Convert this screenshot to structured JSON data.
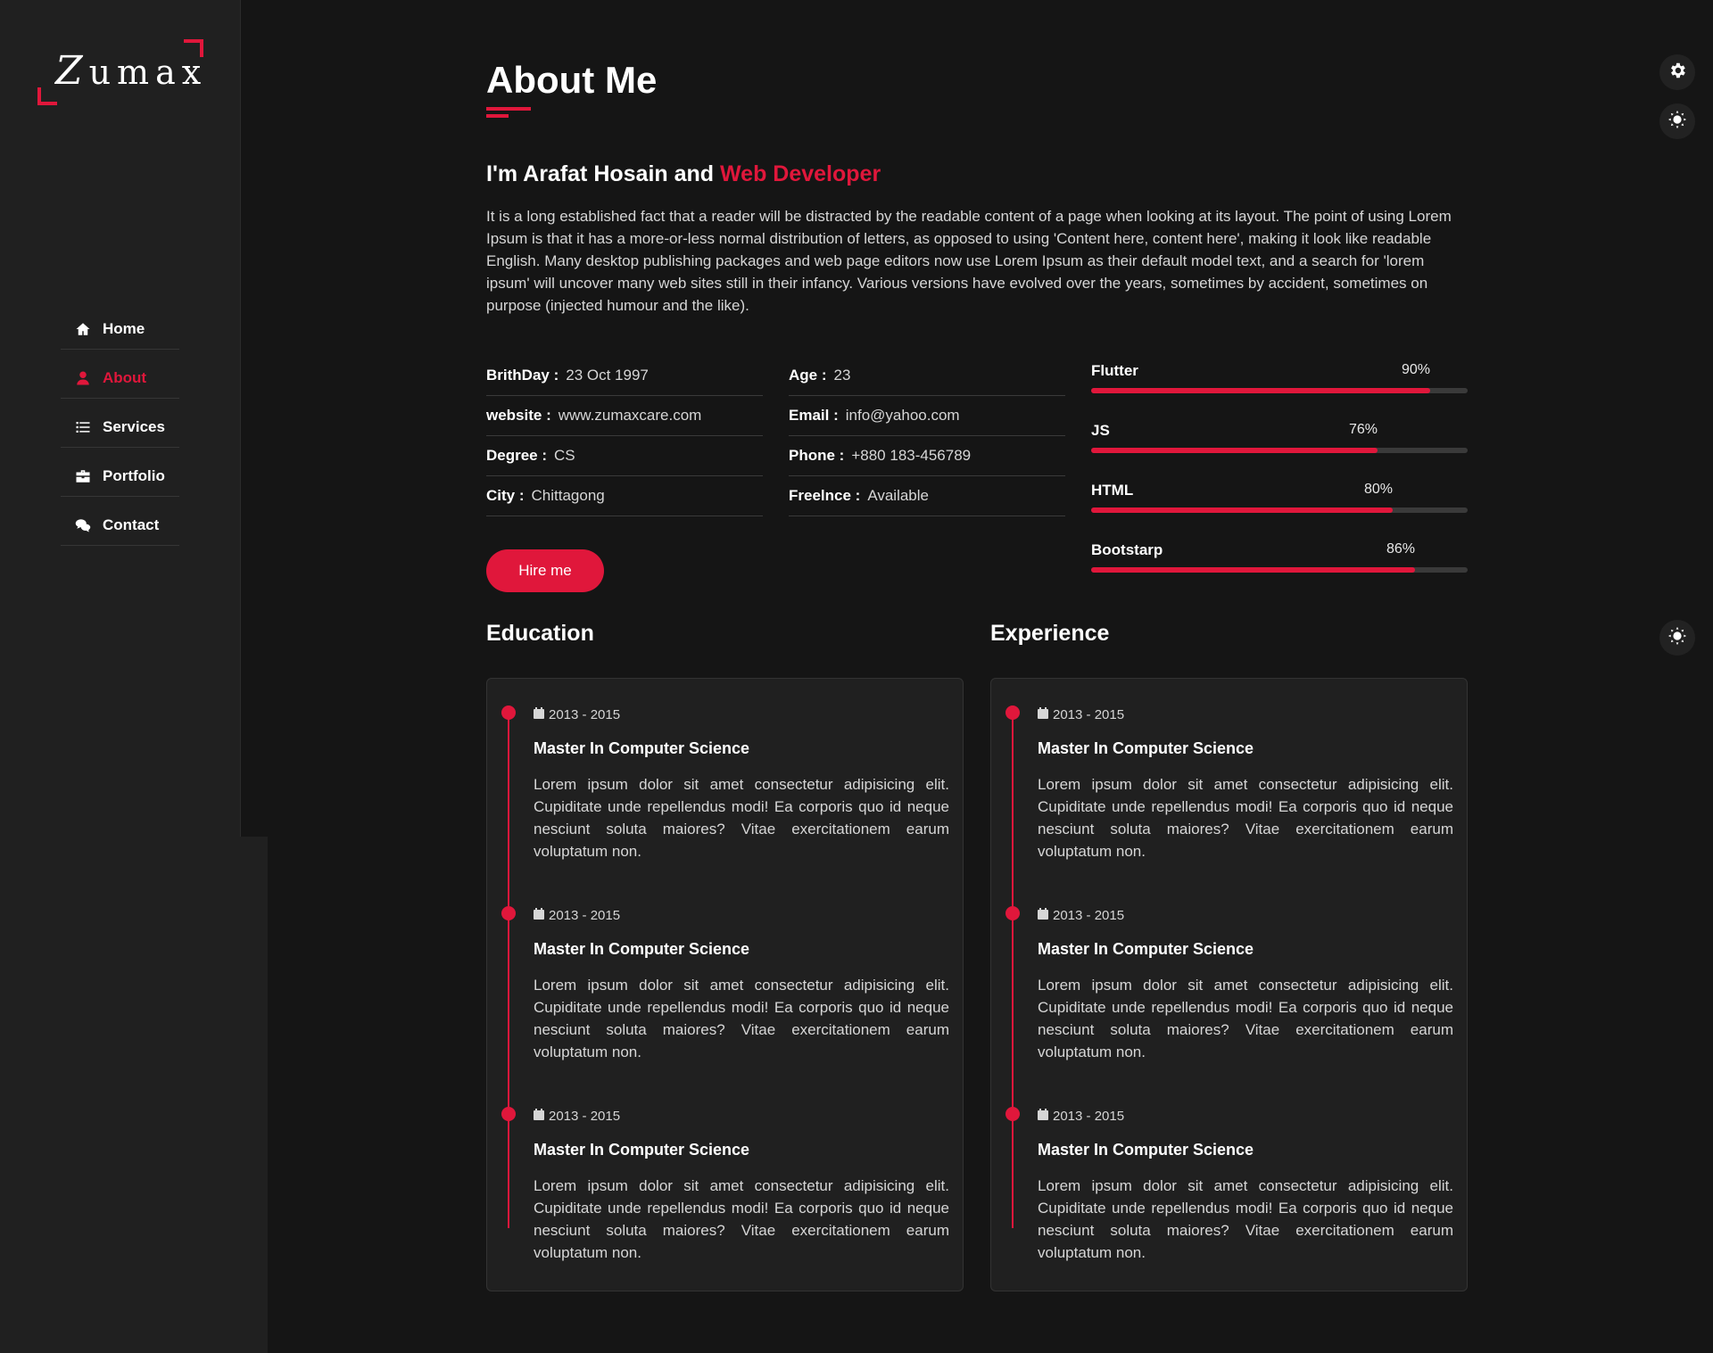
{
  "logo": {
    "first_letter": "Z",
    "rest": "umax"
  },
  "nav": {
    "items": [
      {
        "label": "Home",
        "icon": "home-icon"
      },
      {
        "label": "About",
        "icon": "user-icon"
      },
      {
        "label": "Services",
        "icon": "list-icon"
      },
      {
        "label": "Portfolio",
        "icon": "briefcase-icon"
      },
      {
        "label": "Contact",
        "icon": "comments-icon"
      }
    ],
    "active": "About"
  },
  "fabs": [
    "gear-icon",
    "sun-icon",
    "sun-icon"
  ],
  "about": {
    "title": "About Me",
    "heading_prefix": "I'm Arafat Hosain and",
    "heading_accent": "Web Developer",
    "intro": "It is a long established fact that a reader will be distracted by the readable content of a page when looking at its layout. The point of using Lorem Ipsum is that it has a more-or-less normal distribution of letters, as opposed to using 'Content here, content here', making it look like readable English. Many desktop publishing packages and web page editors now use Lorem Ipsum as their default model text, and a search for 'lorem ipsum' will uncover many web sites still in their infancy. Various versions have evolved over the years, sometimes by accident, sometimes on purpose (injected humour and the like).",
    "info_left": [
      {
        "k": "BrithDay :",
        "v": "23 Oct 1997"
      },
      {
        "k": "website :",
        "v": "www.zumaxcare.com"
      },
      {
        "k": "Degree :",
        "v": "CS"
      },
      {
        "k": "City :",
        "v": "Chittagong"
      }
    ],
    "info_right": [
      {
        "k": "Age :",
        "v": "23"
      },
      {
        "k": "Email :",
        "v": "info@yahoo.com"
      },
      {
        "k": "Phone :",
        "v": "+880 183-456789"
      },
      {
        "k": "Freelnce :",
        "v": "Available"
      }
    ],
    "skills": [
      {
        "name": "Flutter",
        "pct_label": "90%",
        "pct": 90
      },
      {
        "name": "JS",
        "pct_label": "76%",
        "pct": 76
      },
      {
        "name": "HTML",
        "pct_label": "80%",
        "pct": 80
      },
      {
        "name": "Bootstarp",
        "pct_label": "86%",
        "pct": 86
      }
    ],
    "hire_label": "Hire me"
  },
  "education": {
    "title": "Education",
    "entries": [
      {
        "date": "2013 - 2015",
        "title": "Master In Computer Science",
        "desc": "Lorem ipsum dolor sit amet consectetur adipisicing elit. Cupiditate unde repellendus modi! Ea corporis quo id neque nesciunt soluta maiores? Vitae exercitationem earum voluptatum non."
      },
      {
        "date": "2013 - 2015",
        "title": "Master In Computer Science",
        "desc": "Lorem ipsum dolor sit amet consectetur adipisicing elit. Cupiditate unde repellendus modi! Ea corporis quo id neque nesciunt soluta maiores? Vitae exercitationem earum voluptatum non."
      },
      {
        "date": "2013 - 2015",
        "title": "Master In Computer Science",
        "desc": "Lorem ipsum dolor sit amet consectetur adipisicing elit. Cupiditate unde repellendus modi! Ea corporis quo id neque nesciunt soluta maiores? Vitae exercitationem earum voluptatum non."
      }
    ]
  },
  "experience": {
    "title": "Experience",
    "entries": [
      {
        "date": "2013 - 2015",
        "title": "Master In Computer Science",
        "desc": "Lorem ipsum dolor sit amet consectetur adipisicing elit. Cupiditate unde repellendus modi! Ea corporis quo id neque nesciunt soluta maiores? Vitae exercitationem earum voluptatum non."
      },
      {
        "date": "2013 - 2015",
        "title": "Master In Computer Science",
        "desc": "Lorem ipsum dolor sit amet consectetur adipisicing elit. Cupiditate unde repellendus modi! Ea corporis quo id neque nesciunt soluta maiores? Vitae exercitationem earum voluptatum non."
      },
      {
        "date": "2013 - 2015",
        "title": "Master In Computer Science",
        "desc": "Lorem ipsum dolor sit amet consectetur adipisicing elit. Cupiditate unde repellendus modi! Ea corporis quo id neque nesciunt soluta maiores? Vitae exercitationem earum voluptatum non."
      }
    ]
  },
  "colors": {
    "accent": "#e0173b",
    "background": "#151515",
    "panel": "#202020"
  }
}
